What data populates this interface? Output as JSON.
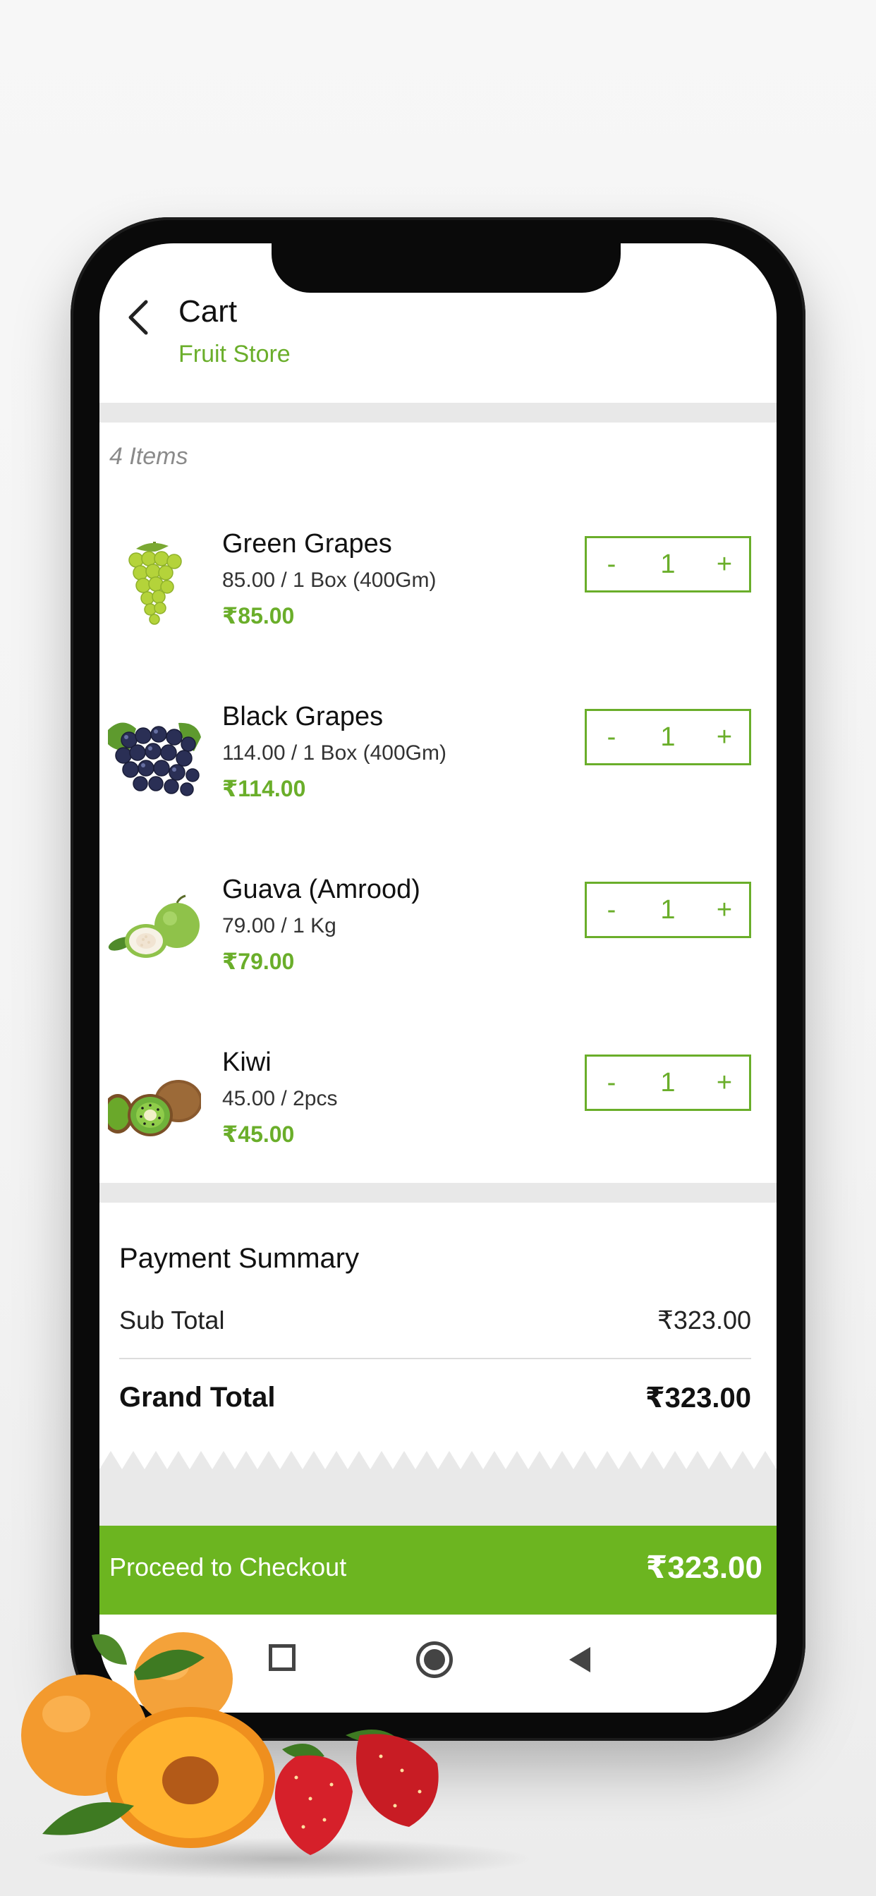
{
  "header": {
    "title": "Cart",
    "store_name": "Fruit Store"
  },
  "cart": {
    "items_count": "4 Items",
    "items": [
      {
        "name": "Green Grapes",
        "description": "85.00 / 1 Box (400Gm)",
        "price": "₹85.00",
        "quantity": "1",
        "icon": "green-grapes-image"
      },
      {
        "name": "Black Grapes",
        "description": "114.00 / 1 Box (400Gm)",
        "price": "₹114.00",
        "quantity": "1",
        "icon": "black-grapes-image"
      },
      {
        "name": "Guava (Amrood)",
        "description": "79.00 / 1 Kg",
        "price": "₹79.00",
        "quantity": "1",
        "icon": "guava-image"
      },
      {
        "name": "Kiwi",
        "description": "45.00 / 2pcs",
        "price": "₹45.00",
        "quantity": "1",
        "icon": "kiwi-image"
      }
    ],
    "stepper": {
      "minus": "-",
      "plus": "+"
    }
  },
  "summary": {
    "title": "Payment Summary",
    "sub_total_label": "Sub Total",
    "sub_total_value": "₹323.00",
    "grand_total_label": "Grand Total",
    "grand_total_value": "₹323.00"
  },
  "checkout": {
    "label": "Proceed to Checkout",
    "amount": "₹323.00"
  },
  "colors": {
    "accent_green": "#6aae2a",
    "checkout_green": "#6cb520"
  }
}
